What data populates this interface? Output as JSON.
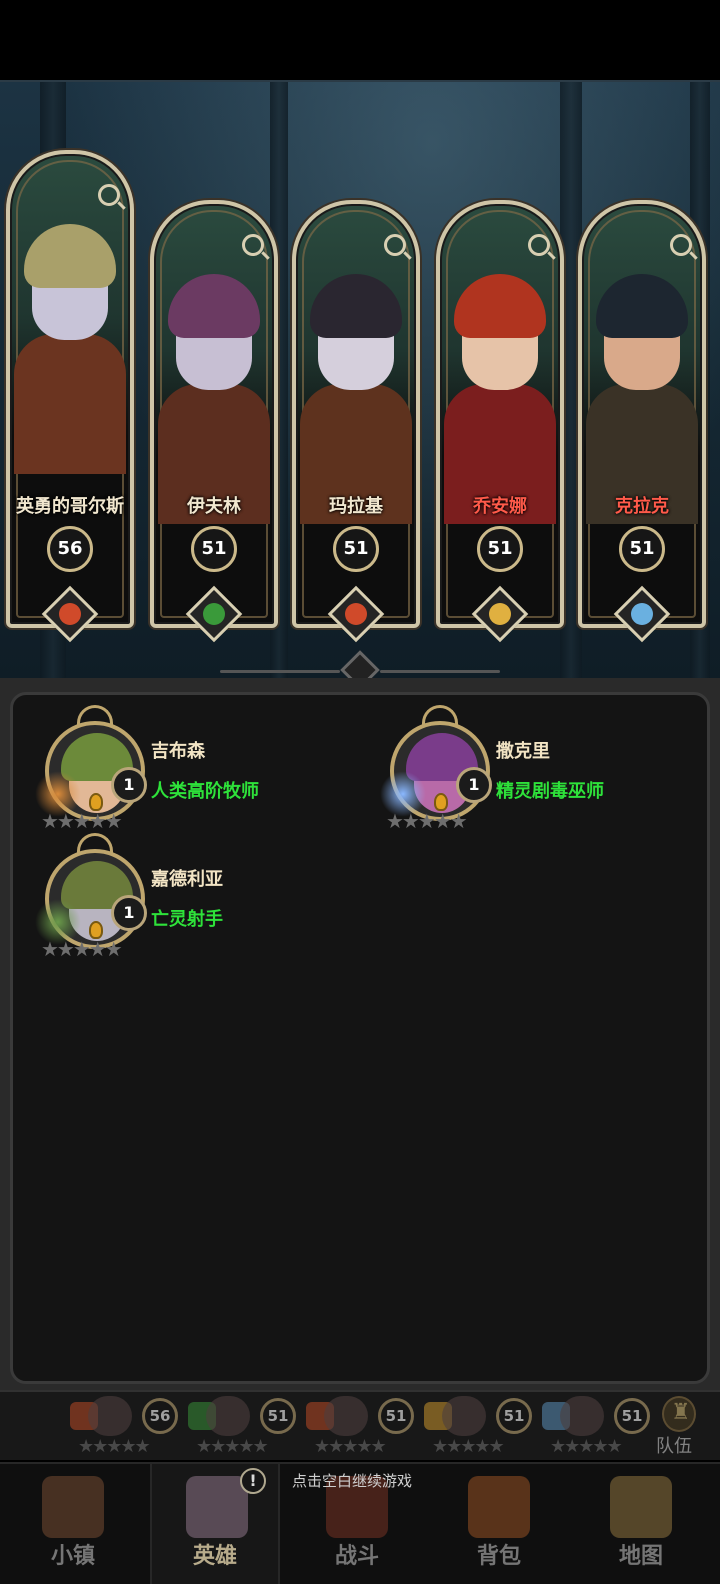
{
  "lineup": [
    {
      "name": "英勇的哥尔斯",
      "level": "56",
      "name_color": "#f1e7cf",
      "skin": "#c8c4d8",
      "hair": "#a9a06a",
      "body": "#6b3420",
      "class_color": "#d04a2a",
      "class_icon": "sword-icon"
    },
    {
      "name": "伊夫林",
      "level": "51",
      "name_color": "#f1e7cf",
      "skin": "#c7bfd3",
      "hair": "#6b3a62",
      "body": "#5c2e1f",
      "class_color": "#3a9a3a",
      "class_icon": "scythe-icon"
    },
    {
      "name": "玛拉基",
      "level": "51",
      "name_color": "#f1e7cf",
      "skin": "#d5cfdc",
      "hair": "#2a2630",
      "body": "#5e321e",
      "class_color": "#d04a2a",
      "class_icon": "sword-icon"
    },
    {
      "name": "乔安娜",
      "level": "51",
      "name_color": "#ff5a4a",
      "skin": "#e6c3a8",
      "hair": "#b0341f",
      "body": "#7b1e1e",
      "class_color": "#e0b040",
      "class_icon": "sun-icon"
    },
    {
      "name": "克拉克",
      "level": "51",
      "name_color": "#ff5a4a",
      "skin": "#d9a98a",
      "hair": "#1d2630",
      "body": "#3a3226",
      "class_color": "#6ab0e0",
      "class_icon": "staff-icon"
    }
  ],
  "roster": [
    {
      "name": "吉布森",
      "class": "人类高阶牧师",
      "level": "1",
      "stars": "★★★★★",
      "skin": "#e2b896",
      "hair": "#6c8a3a",
      "class_color": "#d88a3a",
      "class_icon": "sun-icon"
    },
    {
      "name": "撒克里",
      "class": "精灵剧毒巫师",
      "level": "1",
      "stars": "★★★★★",
      "skin": "#b86aa8",
      "hair": "#7a3c8a",
      "class_color": "#8ab8ff",
      "class_icon": "fire-spell-icon"
    },
    {
      "name": "嘉德利亚",
      "class": "亡灵射手",
      "level": "1",
      "stars": "★★★★★",
      "skin": "#b8b4c0",
      "hair": "#6a7a3a",
      "class_color": "#6a9a4a",
      "class_icon": "bow-icon"
    }
  ],
  "team_bar": {
    "slots": [
      {
        "level": "56",
        "stars": "★★★★★",
        "icon_color": "#b04a2a"
      },
      {
        "level": "51",
        "stars": "★★★★★",
        "icon_color": "#3a8a3a"
      },
      {
        "level": "51",
        "stars": "★★★★★",
        "icon_color": "#b04a2a"
      },
      {
        "level": "51",
        "stars": "★★★★★",
        "icon_color": "#c09030"
      },
      {
        "level": "51",
        "stars": "★★★★★",
        "icon_color": "#5a8ab0"
      }
    ],
    "team_label": "队伍"
  },
  "nav": {
    "town": "小镇",
    "heroes": "英雄",
    "battle": "战斗",
    "bag": "背包",
    "map": "地图",
    "alert": "!",
    "hint": "点击空白继续游戏"
  },
  "colors": {
    "accent_gold": "#cfc5a7",
    "class_green": "#2ee23a",
    "name_red": "#ff5a4a"
  }
}
